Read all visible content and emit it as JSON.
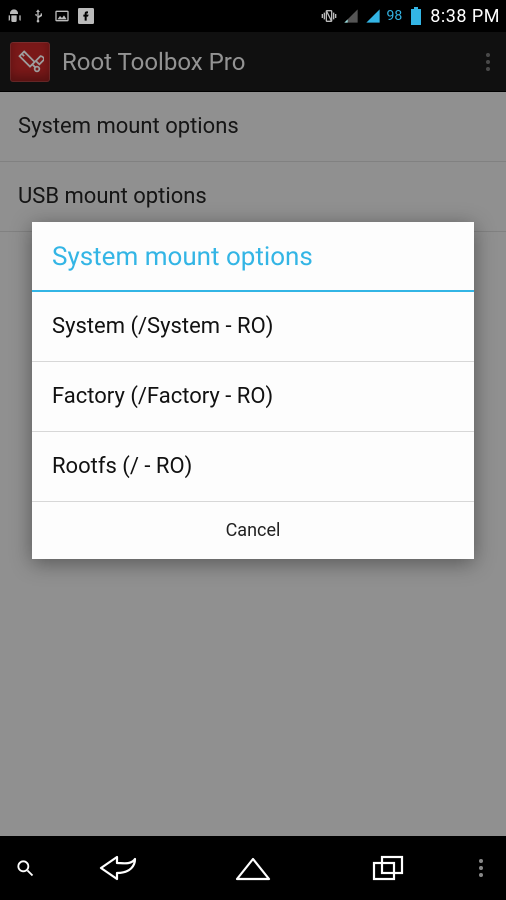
{
  "status_bar": {
    "battery_percent": "98",
    "time": "8:38 PM",
    "icons": [
      "bugdroid",
      "usb",
      "picture",
      "facebook",
      "vibrate",
      "signal-weak",
      "signal",
      "battery"
    ]
  },
  "action_bar": {
    "title": "Root Toolbox Pro"
  },
  "background_list": {
    "items": [
      {
        "label": "System mount options"
      },
      {
        "label": "USB mount options"
      }
    ]
  },
  "dialog": {
    "title": "System mount options",
    "options": [
      {
        "label": "System (/System - RO)"
      },
      {
        "label": "Factory (/Factory - RO)"
      },
      {
        "label": "Rootfs (/ - RO)"
      }
    ],
    "cancel": "Cancel"
  },
  "nav_bar": {
    "buttons": [
      "back",
      "home",
      "recents"
    ]
  }
}
